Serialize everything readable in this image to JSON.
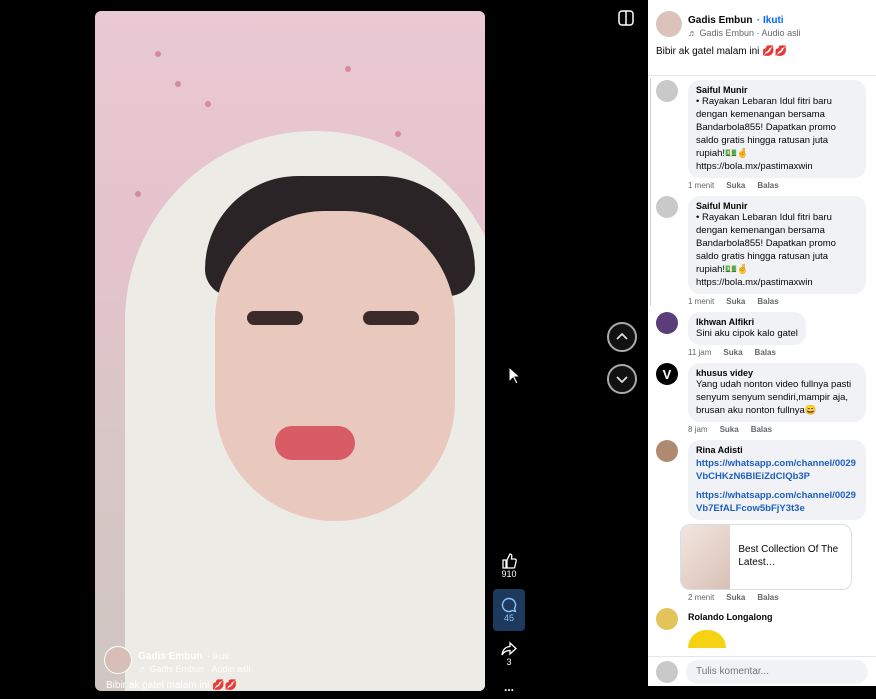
{
  "video": {
    "author": "Gadis Embun",
    "follow": "· Ikuti",
    "audio": "Gadis Embun · Audio asli",
    "caption": "Bibir ak gatel malam ini 💋💋"
  },
  "actions": {
    "likes": "910",
    "comments": "45",
    "shares": "3",
    "more": "..."
  },
  "panel": {
    "author": "Gadis Embun",
    "follow": "· Ikuti",
    "audio": "Gadis Embun · Audio asli",
    "caption": "Bibir ak gatel malam ini 💋💋"
  },
  "comments": [
    {
      "name": "Saiful Munir",
      "text": "• Rayakan Lebaran Idul fitri baru dengan kemenangan bersama Bandarbola855! Dapatkan promo saldo gratis hingga ratusan juta rupiah!💵🤞",
      "link": "https://bola.mx/pastimaxwin",
      "time": "1 menit",
      "like": "Suka",
      "reply": "Balas"
    },
    {
      "name": "Saiful Munir",
      "text": "• Rayakan Lebaran Idul fitri baru dengan kemenangan bersama Bandarbola855! Dapatkan promo saldo gratis hingga ratusan juta rupiah!💵🤞",
      "link": "https://bola.mx/pastimaxwin",
      "time": "1 menit",
      "like": "Suka",
      "reply": "Balas"
    },
    {
      "name": "Ikhwan Alfikri",
      "text": "Sini aku cipok kalo gatel",
      "time": "11 jam",
      "like": "Suka",
      "reply": "Balas"
    },
    {
      "name": "khusus videy",
      "text": "Yang udah nonton video fullnya pasti senyum senyum sendiri,mampir aja, brusan aku nonton fullnya😄",
      "time": "8 jam",
      "like": "Suka",
      "reply": "Balas"
    },
    {
      "name": "Rina Adisti",
      "link1": "https://whatsapp.com/channel/0029VbCHKzN6BIEiZdClQb3P",
      "link2": "https://whatsapp.com/channel/0029Vb7EfALFcow5bFjY3t3e",
      "card": "Best Collection Of The Latest…",
      "time": "2 menit",
      "like": "Suka",
      "reply": "Balas"
    },
    {
      "name": "Rolando Longalong"
    }
  ],
  "composer": {
    "placeholder": "Tulis komentar..."
  }
}
